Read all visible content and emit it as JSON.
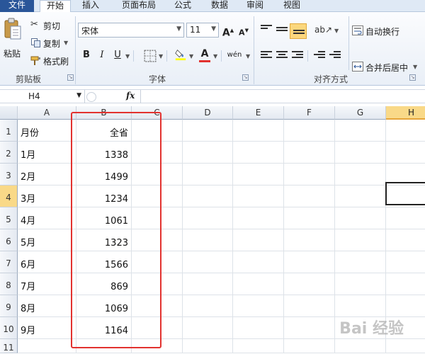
{
  "tabs": [
    "文件",
    "开始",
    "插入",
    "页面布局",
    "公式",
    "数据",
    "审阅",
    "视图"
  ],
  "ribbon": {
    "clipboard": {
      "paste": "粘贴",
      "cut": "剪切",
      "copy": "复制",
      "format_painter": "格式刷",
      "group_label": "剪贴板"
    },
    "font": {
      "font_name": "宋体",
      "font_size": "11",
      "grow": "A",
      "shrink": "A",
      "bold": "B",
      "italic": "I",
      "underline": "U",
      "phonetic": "wén",
      "group_label": "字体"
    },
    "alignment": {
      "wrap_text": "自动换行",
      "merge_center": "合并后居中",
      "group_label": "对齐方式"
    }
  },
  "formula_bar": {
    "name_box": "H4",
    "fx": "fx"
  },
  "columns": [
    "A",
    "B",
    "C",
    "D",
    "E",
    "F",
    "G",
    "H"
  ],
  "selected_column": "H",
  "selected_row": "4",
  "rows": [
    {
      "num": "1",
      "a": "月份",
      "b": "全省"
    },
    {
      "num": "2",
      "a": "1月",
      "b": "1338"
    },
    {
      "num": "3",
      "a": "2月",
      "b": "1499"
    },
    {
      "num": "4",
      "a": "3月",
      "b": "1234"
    },
    {
      "num": "5",
      "a": "4月",
      "b": "1061"
    },
    {
      "num": "6",
      "a": "5月",
      "b": "1323"
    },
    {
      "num": "7",
      "a": "6月",
      "b": "1566"
    },
    {
      "num": "8",
      "a": "7月",
      "b": "869"
    },
    {
      "num": "9",
      "a": "8月",
      "b": "1069"
    },
    {
      "num": "10",
      "a": "9月",
      "b": "1164"
    },
    {
      "num": "11",
      "a": "",
      "b": ""
    }
  ],
  "watermark": "Bai 经验",
  "colors": {
    "file_tab": "#2a5699",
    "highlight": "#e2322f",
    "selected_header": "#f9d988"
  }
}
